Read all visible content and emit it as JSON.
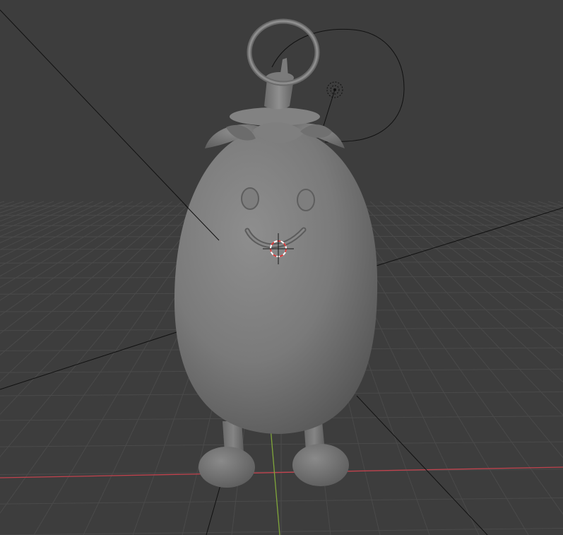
{
  "viewport": {
    "background": "#3d3d3d",
    "grid_color": "#4a4a4a",
    "x_axis_color": "#c0424d",
    "y_axis_color": "#80a63a"
  },
  "scene": {
    "object": "eggplant-keychain",
    "body_color": "#7b7b7b",
    "light": "point-light",
    "camera_lines": "black"
  },
  "icons": [
    "3d-cursor-icon",
    "light-icon"
  ]
}
